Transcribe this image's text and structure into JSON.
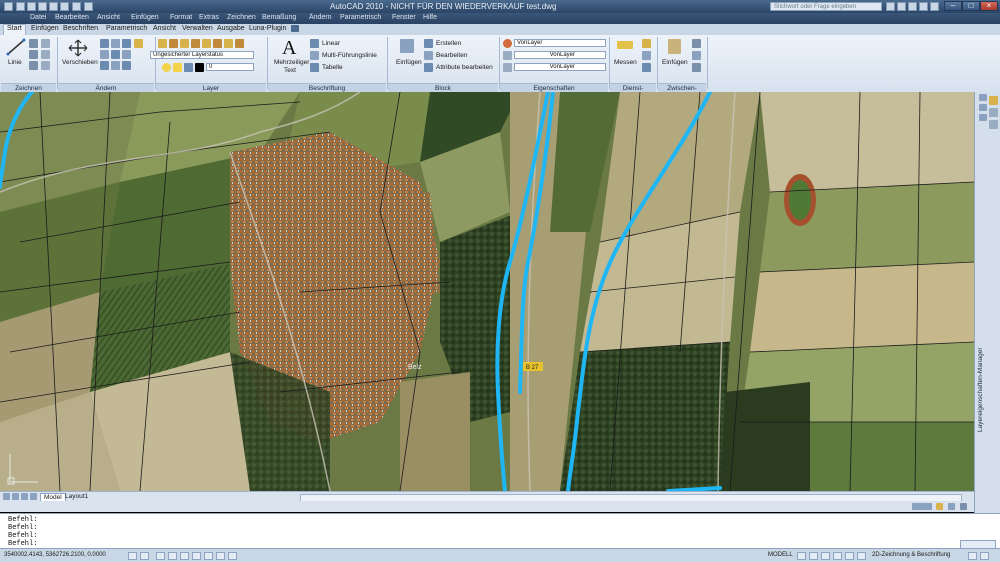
{
  "window": {
    "title": "AutoCAD 2010 - NICHT FÜR DEN WIEDERVERKAUF   test.dwg",
    "search_placeholder": "Stichwort oder Frage eingeben"
  },
  "menu": [
    "Datei",
    "Bearbeiten",
    "Ansicht",
    "Einfügen",
    "Format",
    "Extras",
    "Zeichnen",
    "Bemaßung",
    "Ändern",
    "Parametrisch",
    "Fenster",
    "Hilfe"
  ],
  "ribbon_tabs": [
    "Start",
    "Einfügen",
    "Beschriften",
    "Parametrisch",
    "Ansicht",
    "Verwalten",
    "Ausgabe",
    "Luna-Plugin"
  ],
  "active_tab": "Start",
  "ribbon": {
    "line_label": "Linie",
    "move_label": "Verschieben",
    "layer_state": "Ungesicherter Layerstatus",
    "layer_current": "0",
    "mtext_label1": "Mehrzeiliger",
    "mtext_label2": "Text",
    "linear_label": "Linear",
    "multileader_label": "Multi-Führungslinie",
    "table_label": "Tabelle",
    "insert_label": "Einfügen",
    "create_label": "Erstellen",
    "edit_label": "Bearbeiten",
    "edit_attr_label": "Attribute bearbeiten",
    "prop_color": "VonLayer",
    "prop_linetype": "VonLayer",
    "prop_lineweight": "VonLayer",
    "measure_label": "Messen",
    "paste_label": "Einfügen",
    "panels": {
      "draw": "Zeichnen",
      "modify": "Ändern",
      "layer": "Layer",
      "annotate": "Beschriftung",
      "block": "Block",
      "properties": "Eigenschaften",
      "utilities": "Dienst-",
      "clipboard": "Zwischen-"
    }
  },
  "layout_tabs": [
    "Model",
    "Layout1"
  ],
  "command_lines": [
    "Befehl:",
    "Befehl:",
    "Befehl:",
    "Befehl:"
  ],
  "right_palette_label": "Layereigenschaften-Manager",
  "status": {
    "coords": "3540002.4143, 5362726.2100, 0.0000",
    "model_label": "MODELL",
    "workspace": "2D-Zeichnung & Beschriftung"
  },
  "map_labels": [
    "Belz",
    "B 27"
  ],
  "colors": {
    "title_bar": "#2b4566",
    "ribbon_bg": "#eef3f9",
    "river_line": "#1fb6f5",
    "parcel_line": "#1b1b1b"
  }
}
